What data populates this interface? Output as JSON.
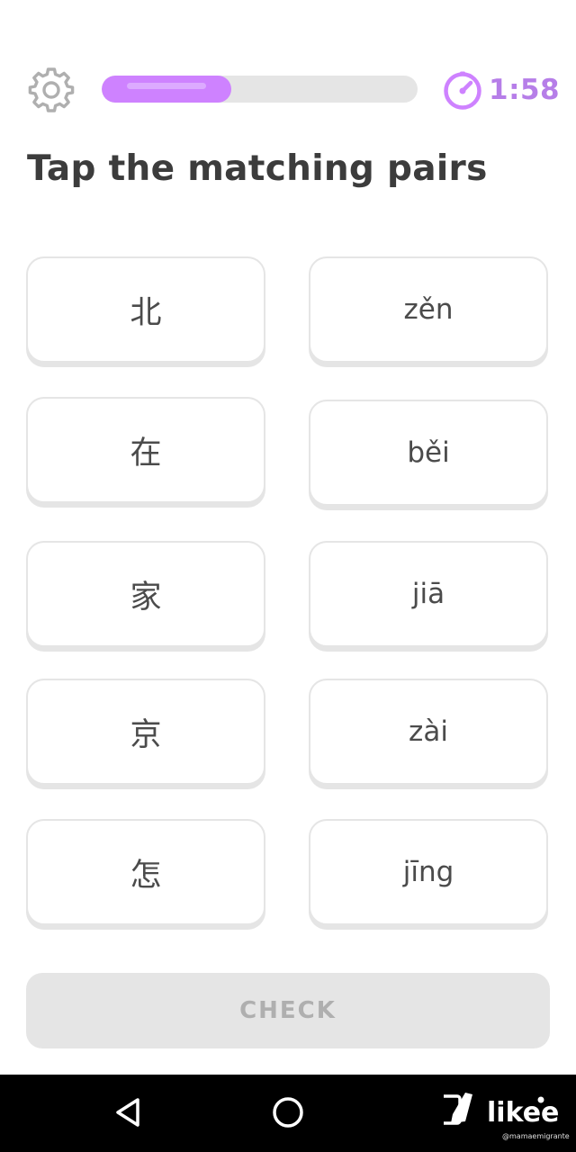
{
  "header": {
    "settings_icon": "gear-icon",
    "timer_icon": "stopwatch-icon",
    "timer": "1:58",
    "progress": 0.41,
    "progress_color": "#ce82ff",
    "timer_color": "#b67ee8"
  },
  "title": "Tap the matching pairs",
  "tiles": {
    "left": [
      "北",
      "在",
      "家",
      "京",
      "怎"
    ],
    "right": [
      "zěn",
      "běi",
      "jiā",
      "zài",
      "jīng"
    ]
  },
  "check_button": "CHECK",
  "navbar": {
    "icons": [
      "back-triangle-icon",
      "home-circle-icon",
      "recents-square-icon",
      "accessibility-icon"
    ]
  },
  "watermark": {
    "brand": "likee",
    "handle": "@mamaemigrante"
  }
}
